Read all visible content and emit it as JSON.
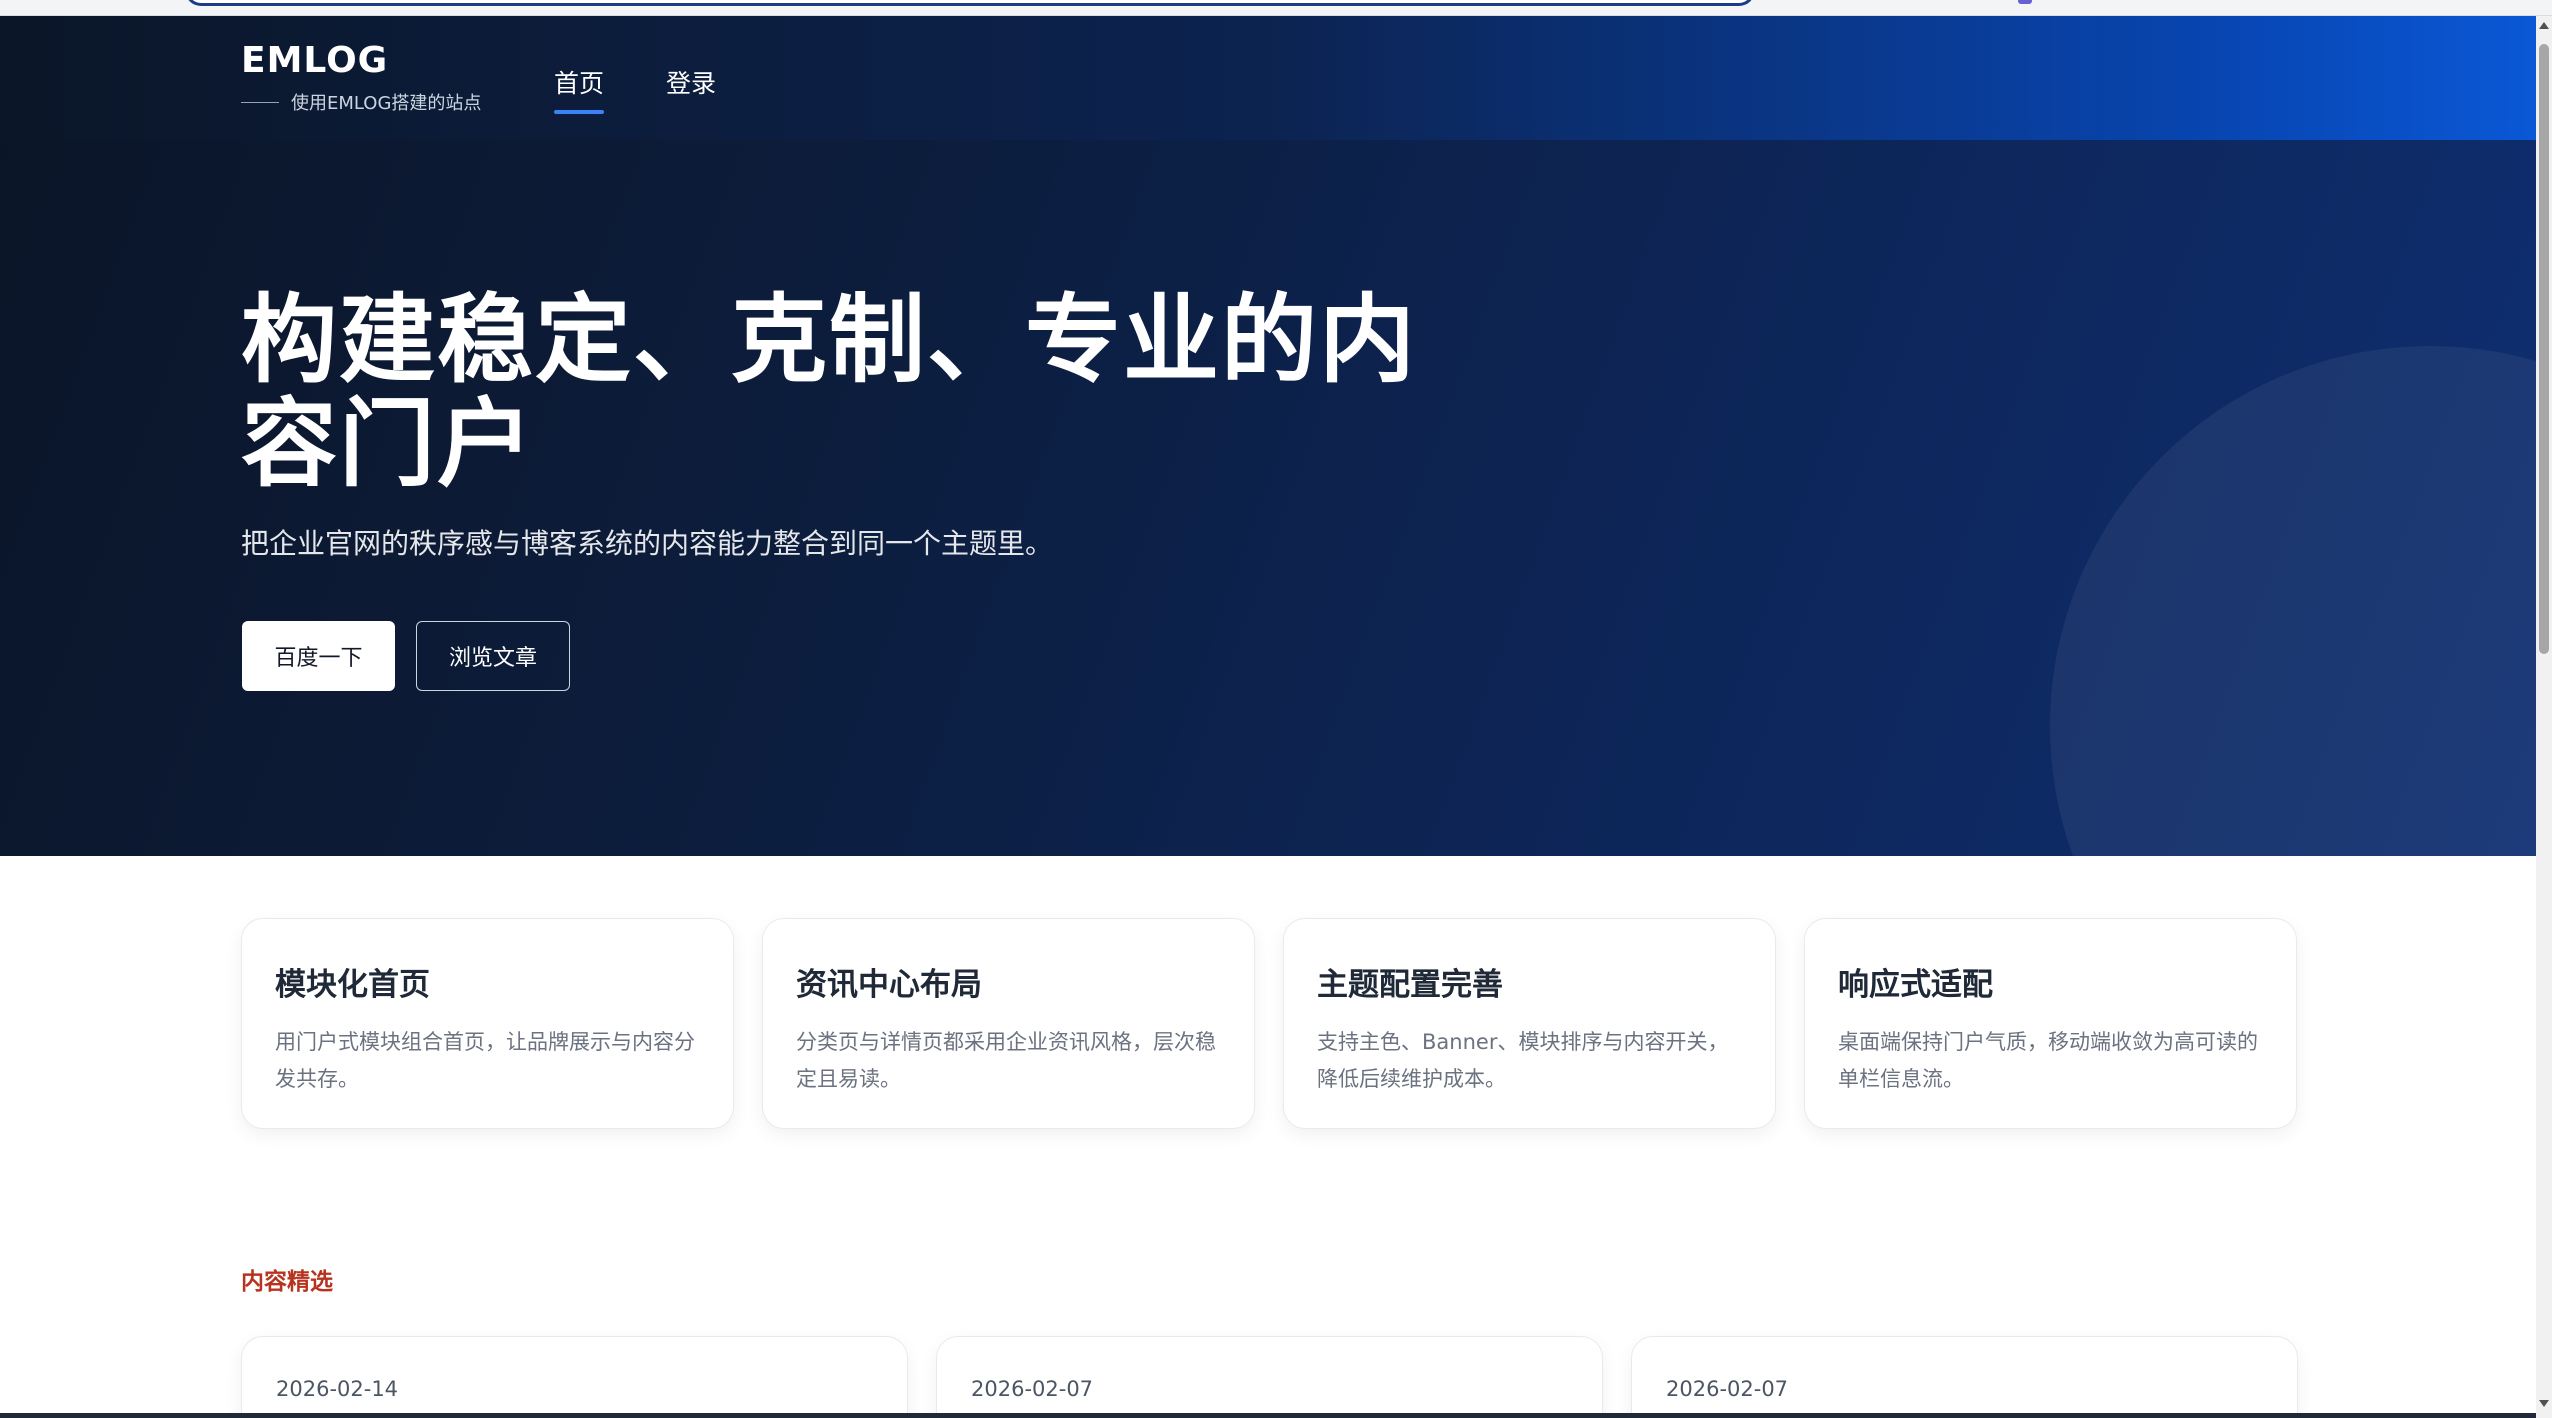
{
  "site": {
    "brand_name": "EMLOG",
    "brand_tagline": "使用EMLOG搭建的站点"
  },
  "nav": {
    "items": [
      {
        "label": "首页",
        "active": true
      },
      {
        "label": "登录",
        "active": false
      }
    ]
  },
  "hero": {
    "title": "构建稳定、克制、专业的内容门户",
    "subtitle": "把企业官网的秩序感与博客系统的内容能力整合到同一个主题里。",
    "primary_button": "百度一下",
    "secondary_button": "浏览文章"
  },
  "features": [
    {
      "title": "模块化首页",
      "desc": "用门户式模块组合首页，让品牌展示与内容分发共存。"
    },
    {
      "title": "资讯中心布局",
      "desc": "分类页与详情页都采用企业资讯风格，层次稳定且易读。"
    },
    {
      "title": "主题配置完善",
      "desc": "支持主色、Banner、模块排序与内容开关，降低后续维护成本。"
    },
    {
      "title": "响应式适配",
      "desc": "桌面端保持门户气质，移动端收敛为高可读的单栏信息流。"
    }
  ],
  "featured": {
    "label": "内容精选",
    "posts": [
      {
        "date": "2026-02-14"
      },
      {
        "date": "2026-02-07"
      },
      {
        "date": "2026-02-07"
      }
    ]
  },
  "colors": {
    "hero_dark": "#0b1527",
    "hero_blue": "#0a58d6",
    "accent": "#3b82f6",
    "section_label": "#b8331f"
  }
}
